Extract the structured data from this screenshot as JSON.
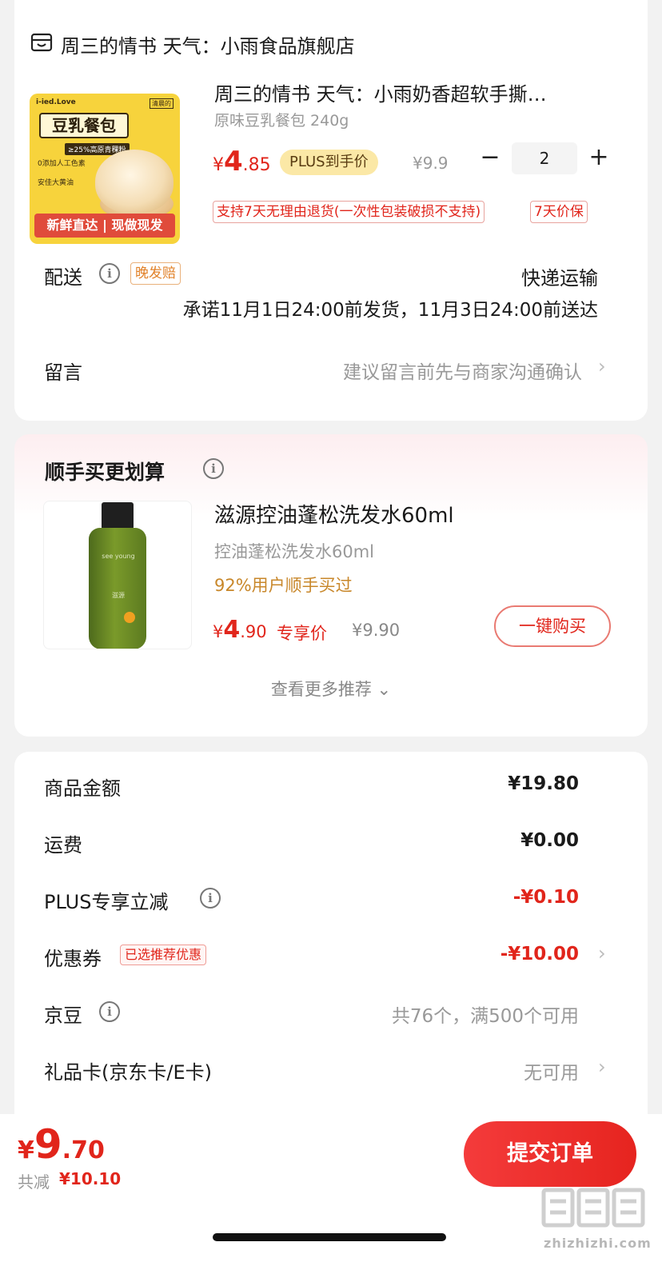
{
  "shop": {
    "icon": "store-icon",
    "name": "周三的情书 天气：小雨食品旗舰店"
  },
  "product": {
    "image": {
      "brand": "i-ied.Love",
      "badge": "清晨的",
      "title": "豆乳餐包",
      "sub": "≥25%高原青稞粉",
      "feature1": "0添加人工色素",
      "feature2": "安佳大黄油",
      "banner": "新鲜直达 | 现做现发"
    },
    "title": "周三的情书 天气：小雨奶香超软手撕…",
    "spec": "原味豆乳餐包 240g",
    "price_yen": "¥",
    "price_int": "4",
    "price_dec": ".85",
    "plus_tag": "PLUS到手价",
    "orig_price": "¥9.9",
    "qty_minus": "−",
    "qty": "2",
    "qty_plus": "+",
    "service_tags": [
      "支持7天无理由退货(一次性包装破损不支持)",
      "7天价保"
    ]
  },
  "delivery": {
    "label": "配送",
    "info_icon": "i",
    "late_tag": "晚发赔",
    "method": "快递运输",
    "promise": "承诺11月1日24:00前发货，11月3日24:00前送达"
  },
  "message": {
    "label": "留言",
    "hint": "建议留言前先与商家沟通确认",
    "chevron": "›"
  },
  "recommend": {
    "title": "顺手买更划算",
    "info_icon": "i",
    "image": {
      "label1": "see young",
      "label2": "滋源"
    },
    "name": "滋源控油蓬松洗发水60ml",
    "spec": "控油蓬松洗发水60ml",
    "buy_pct": "92%用户顺手买过",
    "price_yen": "¥",
    "price_int": "4",
    "price_dec": ".90",
    "exclusive": "专享价",
    "orig_price": "¥9.90",
    "buy_button": "一键购买",
    "see_more": "查看更多推荐 ⌄"
  },
  "fees": {
    "goods_label": "商品金额",
    "goods_value": "¥19.80",
    "shipping_label": "运费",
    "shipping_value": "¥0.00",
    "plus_label": "PLUS专享立减",
    "plus_value": "-¥0.10",
    "coupon_label": "优惠券",
    "coupon_tag": "已选推荐优惠",
    "coupon_value": "-¥10.00",
    "jingdou_label": "京豆",
    "jingdou_value": "共76个，满500个可用",
    "giftcard_label": "礼品卡(京东卡/E卡)",
    "giftcard_value": "无可用",
    "chevron": "›"
  },
  "footer": {
    "total_yen": "¥",
    "total_int": "9",
    "total_dec": ".70",
    "saved_label": "共减",
    "saved_value": "¥10.10",
    "submit": "提交订单"
  },
  "watermark": {
    "text": "zhizhizhi.com",
    "logo": "值值值"
  },
  "colors": {
    "accent": "#e1251b",
    "plus_tag_bg": "#fbe8a6",
    "recommend_pct": "#c8872a",
    "late_tag": "#e1822a"
  }
}
